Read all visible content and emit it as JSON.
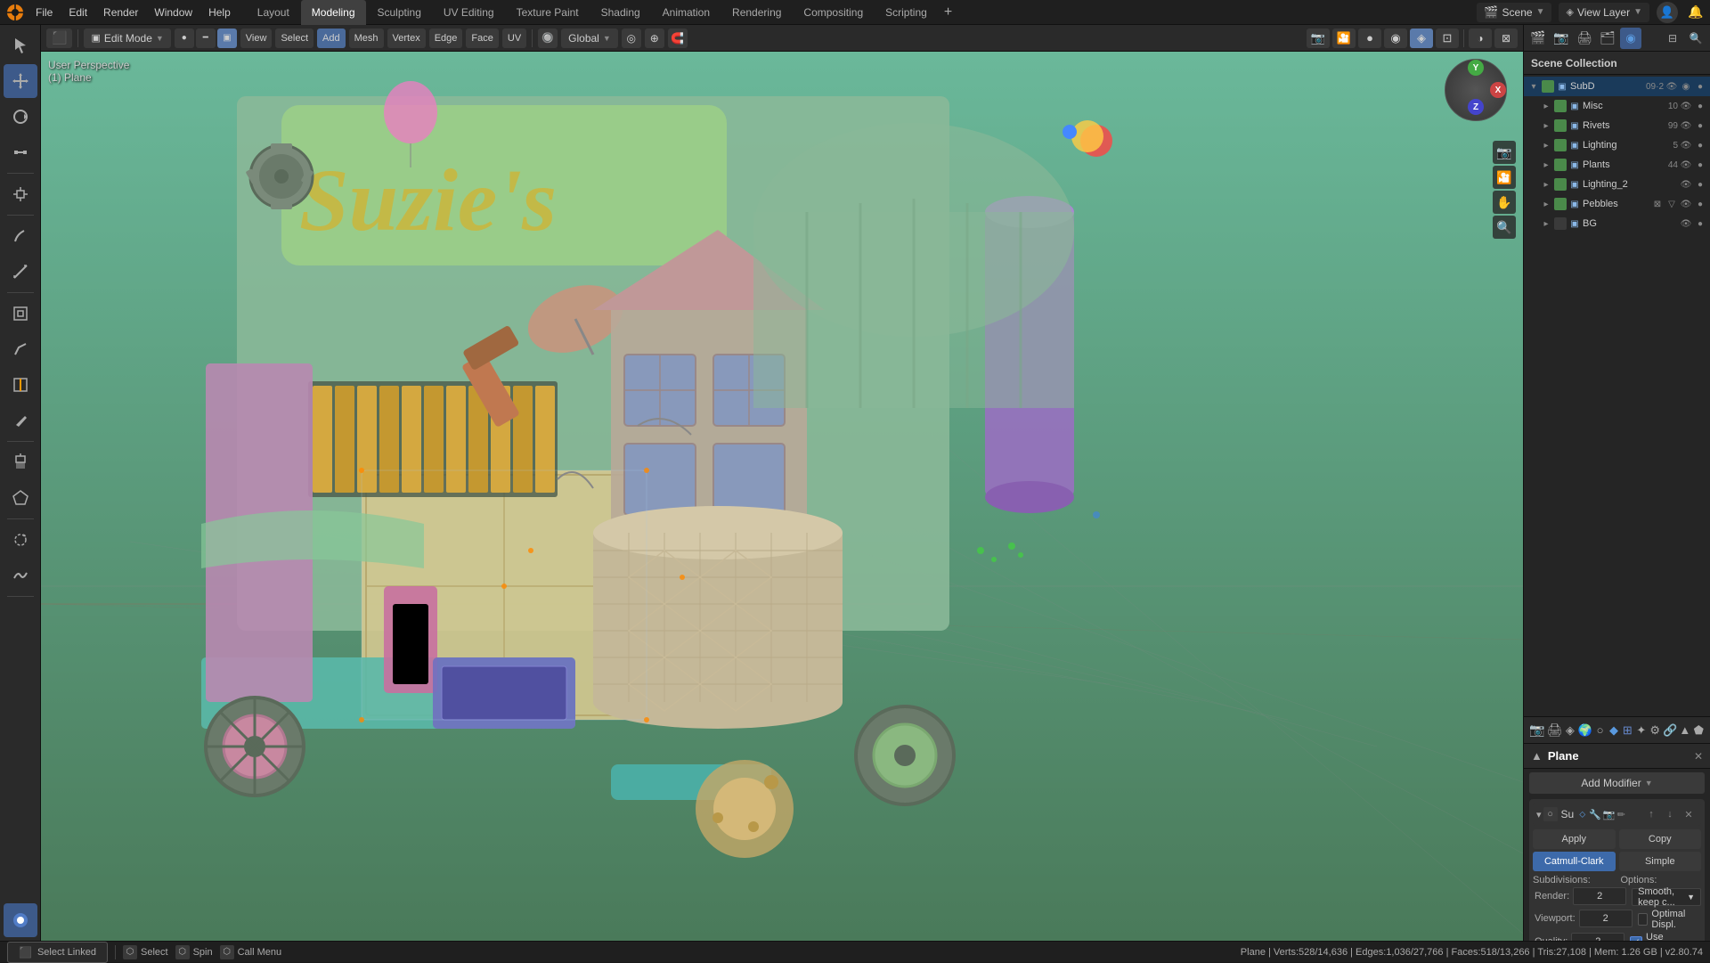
{
  "app": {
    "title": "Blender"
  },
  "top_menu": {
    "items": [
      "File",
      "Edit",
      "Render",
      "Window",
      "Help"
    ]
  },
  "workspace_tabs": [
    {
      "label": "Layout",
      "active": false
    },
    {
      "label": "Modeling",
      "active": true
    },
    {
      "label": "Sculpting",
      "active": false
    },
    {
      "label": "UV Editing",
      "active": false
    },
    {
      "label": "Texture Paint",
      "active": false
    },
    {
      "label": "Shading",
      "active": false
    },
    {
      "label": "Animation",
      "active": false
    },
    {
      "label": "Rendering",
      "active": false
    },
    {
      "label": "Compositing",
      "active": false
    },
    {
      "label": "Scripting",
      "active": false
    }
  ],
  "scene": {
    "name": "Scene",
    "view_layer": "View Layer"
  },
  "editor_header": {
    "mode": "Edit Mode",
    "view_label": "View",
    "select_label": "Select",
    "add_label": "Add",
    "mesh_label": "Mesh",
    "vertex_label": "Vertex",
    "edge_label": "Edge",
    "face_label": "Face",
    "uv_label": "UV",
    "transform_global": "Global",
    "pivot_icon": "⊙"
  },
  "viewport": {
    "info_line1": "User Perspective",
    "info_line2": "(1) Plane"
  },
  "outliner": {
    "title": "Scene Collection",
    "items": [
      {
        "label": "SubD",
        "count": "09·2",
        "indent": 0,
        "expanded": true,
        "checked": true,
        "icon": "▷",
        "is_parent": true
      },
      {
        "label": "Misc",
        "count": "10",
        "indent": 1,
        "expanded": false,
        "checked": true,
        "icon": "▷",
        "is_parent": true
      },
      {
        "label": "Rivets",
        "count": "99",
        "indent": 1,
        "expanded": false,
        "checked": true,
        "icon": "▷",
        "is_parent": true
      },
      {
        "label": "Lighting",
        "count": "5",
        "indent": 1,
        "expanded": false,
        "checked": true,
        "icon": "▷",
        "is_parent": true
      },
      {
        "label": "Plants",
        "count": "44",
        "indent": 1,
        "expanded": false,
        "checked": true,
        "icon": "▷",
        "is_parent": true
      },
      {
        "label": "Lighting_2",
        "count": "",
        "indent": 1,
        "expanded": false,
        "checked": true,
        "icon": "▷",
        "is_parent": true
      },
      {
        "label": "Pebbles",
        "count": "",
        "indent": 1,
        "expanded": false,
        "checked": true,
        "icon": "▷",
        "is_parent": true
      },
      {
        "label": "BG",
        "count": "",
        "indent": 1,
        "expanded": false,
        "checked": false,
        "icon": "▷",
        "is_parent": true
      }
    ]
  },
  "properties": {
    "object_name": "Plane",
    "modifier_name": "Su",
    "add_modifier_label": "Add Modifier",
    "apply_label": "Apply",
    "copy_label": "Copy",
    "catmull_clark_label": "Catmull-Clark",
    "simple_label": "Simple",
    "subdivisions_label": "Subdivisions:",
    "options_label": "Options:",
    "render_label": "Render:",
    "render_value": "2",
    "viewport_label": "Viewport:",
    "viewport_value": "2",
    "quality_label": "Quality:",
    "quality_value": "2",
    "smooth_label": "Smooth, keep c...",
    "optimal_disp_label": "Optimal Displ.",
    "use_creases_label": "Use Creases"
  },
  "status_bar": {
    "select_label": "Select",
    "spin_label": "Spin",
    "call_menu_label": "Call Menu",
    "select_linked_label": "Select Linked",
    "stats": "Plane | Verts:528/14,636 | Edges:1,036/27,766 | Faces:518/13,266 | Tris:27,108 | Mem: 1.26 GB | v2.80.74"
  },
  "colors": {
    "accent_blue": "#3d6aaa",
    "active_blue": "#3d5a8a",
    "bg_dark": "#1f1f1f",
    "bg_mid": "#252525",
    "bg_panel": "#2a2a2a"
  }
}
